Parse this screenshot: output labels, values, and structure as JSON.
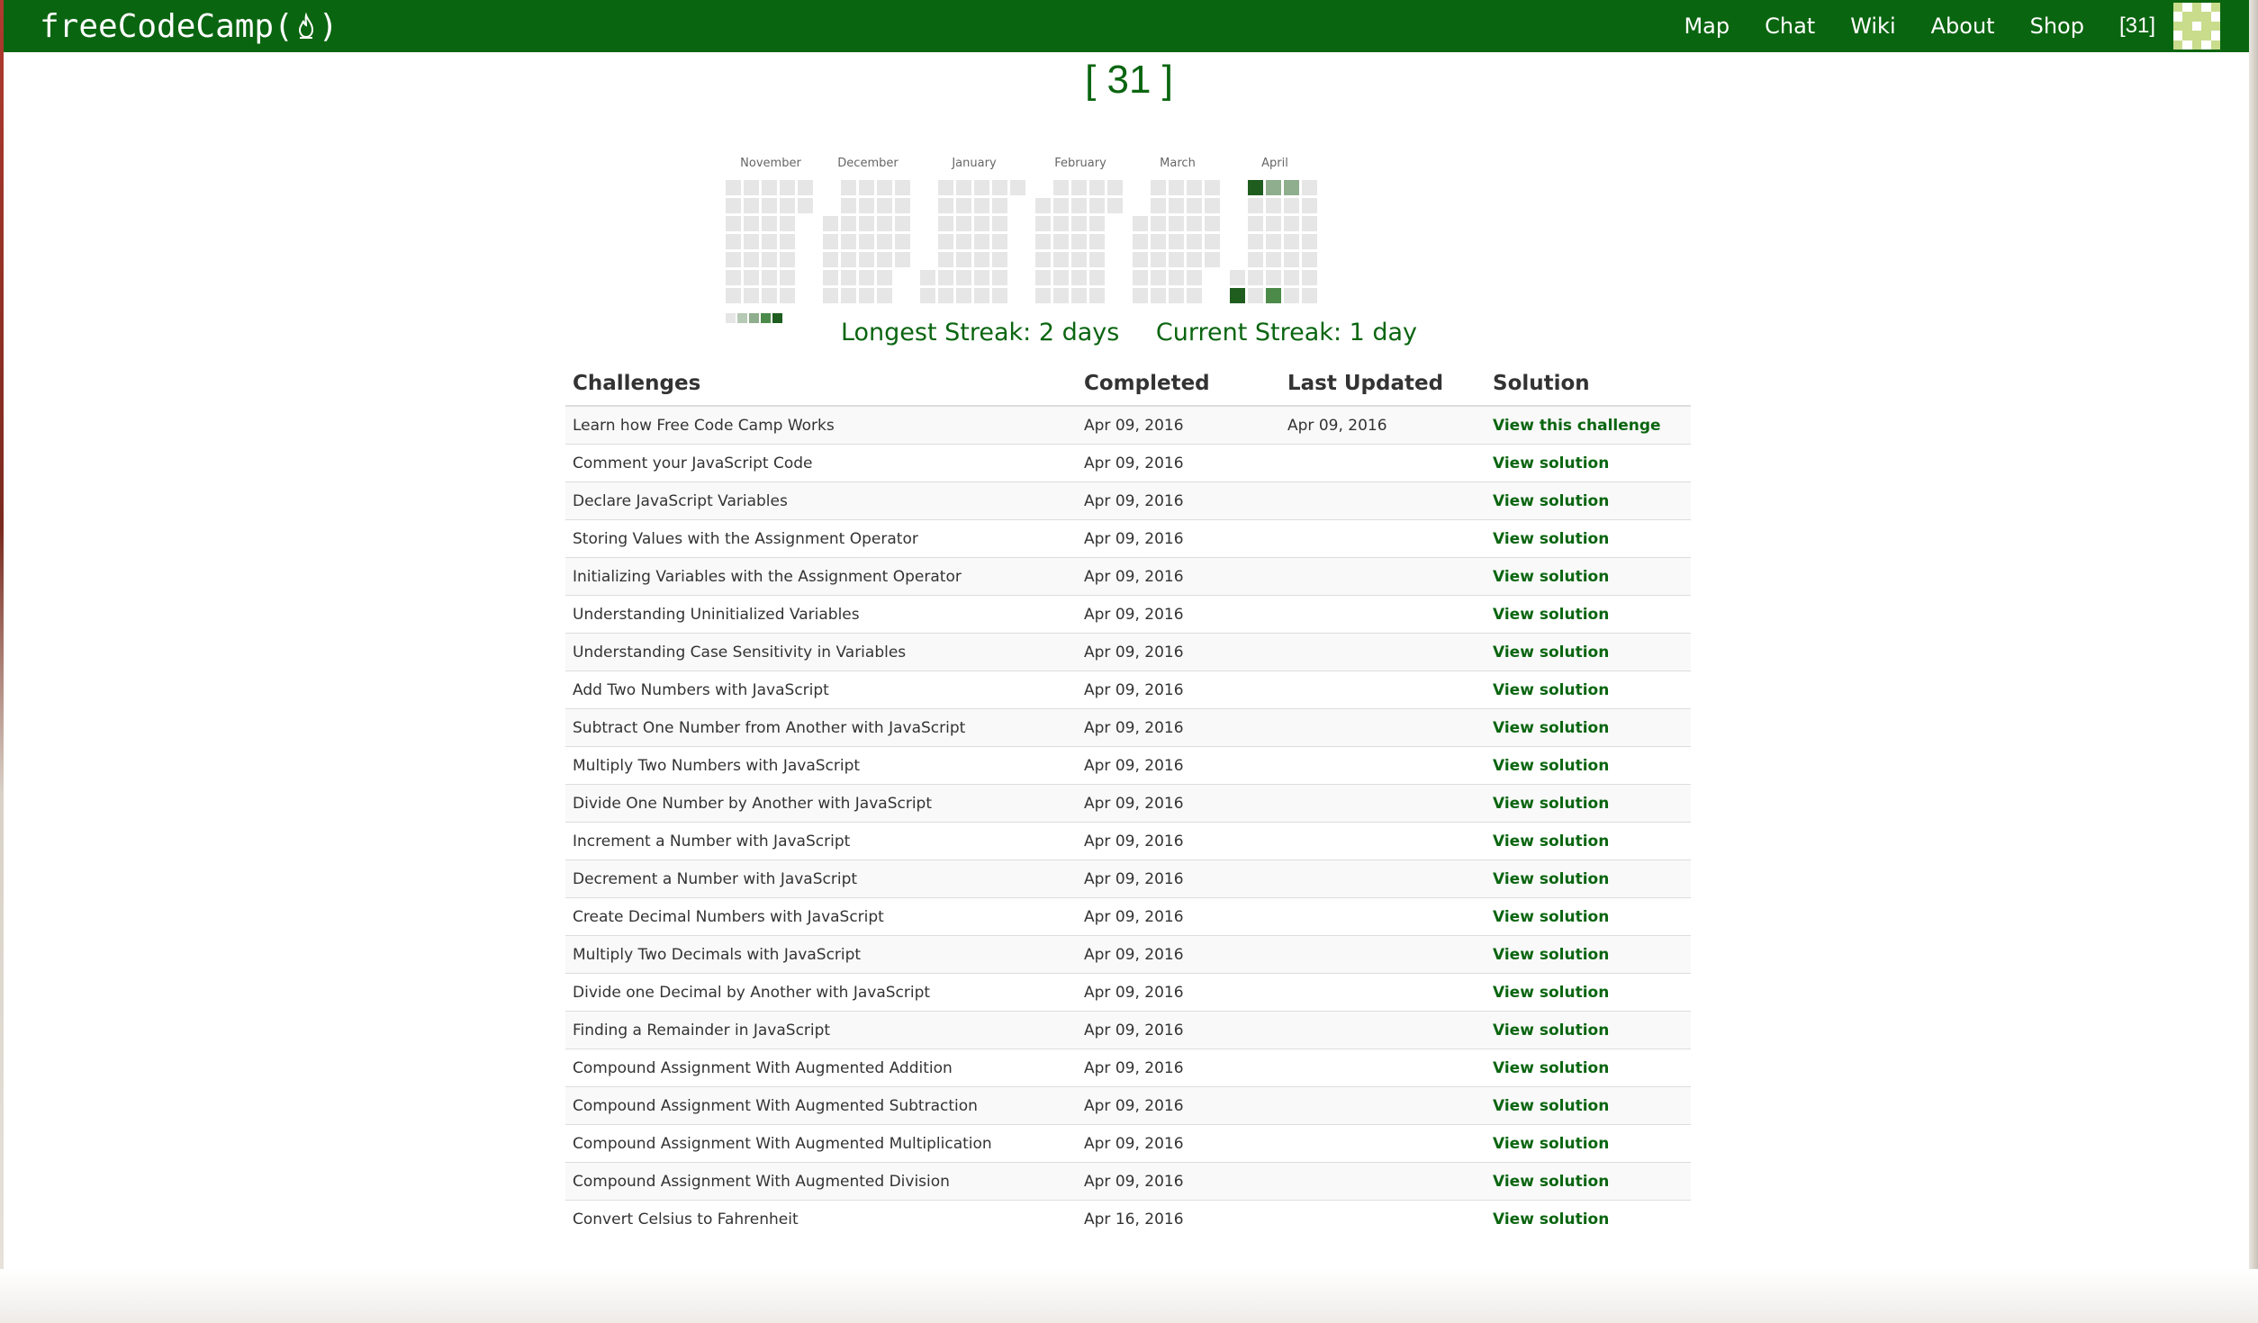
{
  "navbar": {
    "brand_prefix": "freeCodeCamp(",
    "brand_suffix": ")",
    "links": [
      "Map",
      "Chat",
      "Wiki",
      "About",
      "Shop"
    ],
    "points": "[31]",
    "bg_color": "#0a6510"
  },
  "profile": {
    "points_title": "[ 31 ]"
  },
  "calendar": {
    "months": [
      "November",
      "December",
      "January",
      "February",
      "March",
      "April"
    ],
    "month_first_weekday": [
      0,
      2,
      5,
      1,
      2,
      5
    ],
    "month_days": [
      30,
      31,
      31,
      29,
      31,
      30
    ],
    "activity": [
      {
        "month": "April",
        "day": 2,
        "level": 4
      },
      {
        "month": "April",
        "day": 3,
        "level": 4
      },
      {
        "month": "April",
        "day": 10,
        "level": 2
      },
      {
        "month": "April",
        "day": 17,
        "level": 2
      },
      {
        "month": "April",
        "day": 16,
        "level": 3
      }
    ],
    "level_colors": [
      "#e6e6e6",
      "#b6c9b5",
      "#8fae8d",
      "#4c8a4a",
      "#1f5d1f"
    ],
    "legend_levels": [
      0,
      1,
      2,
      3,
      4
    ]
  },
  "streaks": {
    "longest": "Longest Streak: 2 days",
    "current": "Current Streak: 1 day"
  },
  "table": {
    "headers": [
      "Challenges",
      "Completed",
      "Last Updated",
      "Solution"
    ],
    "rows": [
      {
        "challenge": "Learn how Free Code Camp Works",
        "completed": "Apr 09, 2016",
        "updated": "Apr 09, 2016",
        "solution": "View this challenge"
      },
      {
        "challenge": "Comment your JavaScript Code",
        "completed": "Apr 09, 2016",
        "updated": "",
        "solution": "View solution"
      },
      {
        "challenge": "Declare JavaScript Variables",
        "completed": "Apr 09, 2016",
        "updated": "",
        "solution": "View solution"
      },
      {
        "challenge": "Storing Values with the Assignment Operator",
        "completed": "Apr 09, 2016",
        "updated": "",
        "solution": "View solution"
      },
      {
        "challenge": "Initializing Variables with the Assignment Operator",
        "completed": "Apr 09, 2016",
        "updated": "",
        "solution": "View solution"
      },
      {
        "challenge": "Understanding Uninitialized Variables",
        "completed": "Apr 09, 2016",
        "updated": "",
        "solution": "View solution"
      },
      {
        "challenge": "Understanding Case Sensitivity in Variables",
        "completed": "Apr 09, 2016",
        "updated": "",
        "solution": "View solution"
      },
      {
        "challenge": "Add Two Numbers with JavaScript",
        "completed": "Apr 09, 2016",
        "updated": "",
        "solution": "View solution"
      },
      {
        "challenge": "Subtract One Number from Another with JavaScript",
        "completed": "Apr 09, 2016",
        "updated": "",
        "solution": "View solution"
      },
      {
        "challenge": "Multiply Two Numbers with JavaScript",
        "completed": "Apr 09, 2016",
        "updated": "",
        "solution": "View solution"
      },
      {
        "challenge": "Divide One Number by Another with JavaScript",
        "completed": "Apr 09, 2016",
        "updated": "",
        "solution": "View solution"
      },
      {
        "challenge": "Increment a Number with JavaScript",
        "completed": "Apr 09, 2016",
        "updated": "",
        "solution": "View solution"
      },
      {
        "challenge": "Decrement a Number with JavaScript",
        "completed": "Apr 09, 2016",
        "updated": "",
        "solution": "View solution"
      },
      {
        "challenge": "Create Decimal Numbers with JavaScript",
        "completed": "Apr 09, 2016",
        "updated": "",
        "solution": "View solution"
      },
      {
        "challenge": "Multiply Two Decimals with JavaScript",
        "completed": "Apr 09, 2016",
        "updated": "",
        "solution": "View solution"
      },
      {
        "challenge": "Divide one Decimal by Another with JavaScript",
        "completed": "Apr 09, 2016",
        "updated": "",
        "solution": "View solution"
      },
      {
        "challenge": "Finding a Remainder in JavaScript",
        "completed": "Apr 09, 2016",
        "updated": "",
        "solution": "View solution"
      },
      {
        "challenge": "Compound Assignment With Augmented Addition",
        "completed": "Apr 09, 2016",
        "updated": "",
        "solution": "View solution"
      },
      {
        "challenge": "Compound Assignment With Augmented Subtraction",
        "completed": "Apr 09, 2016",
        "updated": "",
        "solution": "View solution"
      },
      {
        "challenge": "Compound Assignment With Augmented Multiplication",
        "completed": "Apr 09, 2016",
        "updated": "",
        "solution": "View solution"
      },
      {
        "challenge": "Compound Assignment With Augmented Division",
        "completed": "Apr 09, 2016",
        "updated": "",
        "solution": "View solution"
      },
      {
        "challenge": "Convert Celsius to Fahrenheit",
        "completed": "Apr 16, 2016",
        "updated": "",
        "solution": "View solution"
      }
    ]
  },
  "colors": {
    "accent": "#0a6510",
    "text": "#333333",
    "avatar_light": "#c8dc8c",
    "avatar_white": "#ffffff"
  }
}
